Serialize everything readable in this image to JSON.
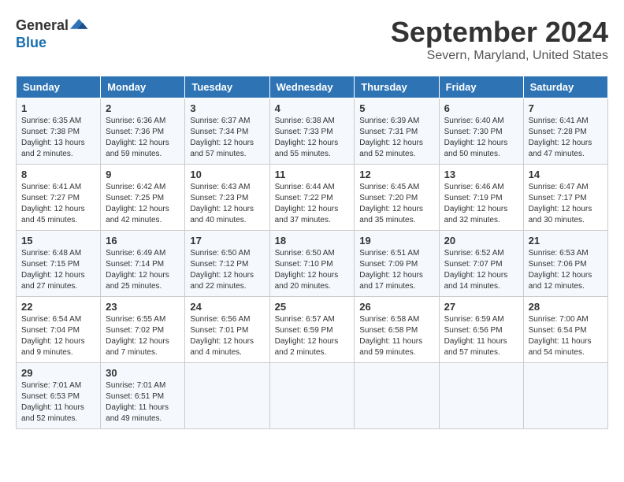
{
  "logo": {
    "general": "General",
    "blue": "Blue"
  },
  "title": "September 2024",
  "location": "Severn, Maryland, United States",
  "days_of_week": [
    "Sunday",
    "Monday",
    "Tuesday",
    "Wednesday",
    "Thursday",
    "Friday",
    "Saturday"
  ],
  "weeks": [
    [
      {
        "day": "1",
        "content": "Sunrise: 6:35 AM\nSunset: 7:38 PM\nDaylight: 13 hours\nand 2 minutes."
      },
      {
        "day": "2",
        "content": "Sunrise: 6:36 AM\nSunset: 7:36 PM\nDaylight: 12 hours\nand 59 minutes."
      },
      {
        "day": "3",
        "content": "Sunrise: 6:37 AM\nSunset: 7:34 PM\nDaylight: 12 hours\nand 57 minutes."
      },
      {
        "day": "4",
        "content": "Sunrise: 6:38 AM\nSunset: 7:33 PM\nDaylight: 12 hours\nand 55 minutes."
      },
      {
        "day": "5",
        "content": "Sunrise: 6:39 AM\nSunset: 7:31 PM\nDaylight: 12 hours\nand 52 minutes."
      },
      {
        "day": "6",
        "content": "Sunrise: 6:40 AM\nSunset: 7:30 PM\nDaylight: 12 hours\nand 50 minutes."
      },
      {
        "day": "7",
        "content": "Sunrise: 6:41 AM\nSunset: 7:28 PM\nDaylight: 12 hours\nand 47 minutes."
      }
    ],
    [
      {
        "day": "8",
        "content": "Sunrise: 6:41 AM\nSunset: 7:27 PM\nDaylight: 12 hours\nand 45 minutes."
      },
      {
        "day": "9",
        "content": "Sunrise: 6:42 AM\nSunset: 7:25 PM\nDaylight: 12 hours\nand 42 minutes."
      },
      {
        "day": "10",
        "content": "Sunrise: 6:43 AM\nSunset: 7:23 PM\nDaylight: 12 hours\nand 40 minutes."
      },
      {
        "day": "11",
        "content": "Sunrise: 6:44 AM\nSunset: 7:22 PM\nDaylight: 12 hours\nand 37 minutes."
      },
      {
        "day": "12",
        "content": "Sunrise: 6:45 AM\nSunset: 7:20 PM\nDaylight: 12 hours\nand 35 minutes."
      },
      {
        "day": "13",
        "content": "Sunrise: 6:46 AM\nSunset: 7:19 PM\nDaylight: 12 hours\nand 32 minutes."
      },
      {
        "day": "14",
        "content": "Sunrise: 6:47 AM\nSunset: 7:17 PM\nDaylight: 12 hours\nand 30 minutes."
      }
    ],
    [
      {
        "day": "15",
        "content": "Sunrise: 6:48 AM\nSunset: 7:15 PM\nDaylight: 12 hours\nand 27 minutes."
      },
      {
        "day": "16",
        "content": "Sunrise: 6:49 AM\nSunset: 7:14 PM\nDaylight: 12 hours\nand 25 minutes."
      },
      {
        "day": "17",
        "content": "Sunrise: 6:50 AM\nSunset: 7:12 PM\nDaylight: 12 hours\nand 22 minutes."
      },
      {
        "day": "18",
        "content": "Sunrise: 6:50 AM\nSunset: 7:10 PM\nDaylight: 12 hours\nand 20 minutes."
      },
      {
        "day": "19",
        "content": "Sunrise: 6:51 AM\nSunset: 7:09 PM\nDaylight: 12 hours\nand 17 minutes."
      },
      {
        "day": "20",
        "content": "Sunrise: 6:52 AM\nSunset: 7:07 PM\nDaylight: 12 hours\nand 14 minutes."
      },
      {
        "day": "21",
        "content": "Sunrise: 6:53 AM\nSunset: 7:06 PM\nDaylight: 12 hours\nand 12 minutes."
      }
    ],
    [
      {
        "day": "22",
        "content": "Sunrise: 6:54 AM\nSunset: 7:04 PM\nDaylight: 12 hours\nand 9 minutes."
      },
      {
        "day": "23",
        "content": "Sunrise: 6:55 AM\nSunset: 7:02 PM\nDaylight: 12 hours\nand 7 minutes."
      },
      {
        "day": "24",
        "content": "Sunrise: 6:56 AM\nSunset: 7:01 PM\nDaylight: 12 hours\nand 4 minutes."
      },
      {
        "day": "25",
        "content": "Sunrise: 6:57 AM\nSunset: 6:59 PM\nDaylight: 12 hours\nand 2 minutes."
      },
      {
        "day": "26",
        "content": "Sunrise: 6:58 AM\nSunset: 6:58 PM\nDaylight: 11 hours\nand 59 minutes."
      },
      {
        "day": "27",
        "content": "Sunrise: 6:59 AM\nSunset: 6:56 PM\nDaylight: 11 hours\nand 57 minutes."
      },
      {
        "day": "28",
        "content": "Sunrise: 7:00 AM\nSunset: 6:54 PM\nDaylight: 11 hours\nand 54 minutes."
      }
    ],
    [
      {
        "day": "29",
        "content": "Sunrise: 7:01 AM\nSunset: 6:53 PM\nDaylight: 11 hours\nand 52 minutes."
      },
      {
        "day": "30",
        "content": "Sunrise: 7:01 AM\nSunset: 6:51 PM\nDaylight: 11 hours\nand 49 minutes."
      },
      {
        "day": "",
        "content": ""
      },
      {
        "day": "",
        "content": ""
      },
      {
        "day": "",
        "content": ""
      },
      {
        "day": "",
        "content": ""
      },
      {
        "day": "",
        "content": ""
      }
    ]
  ]
}
